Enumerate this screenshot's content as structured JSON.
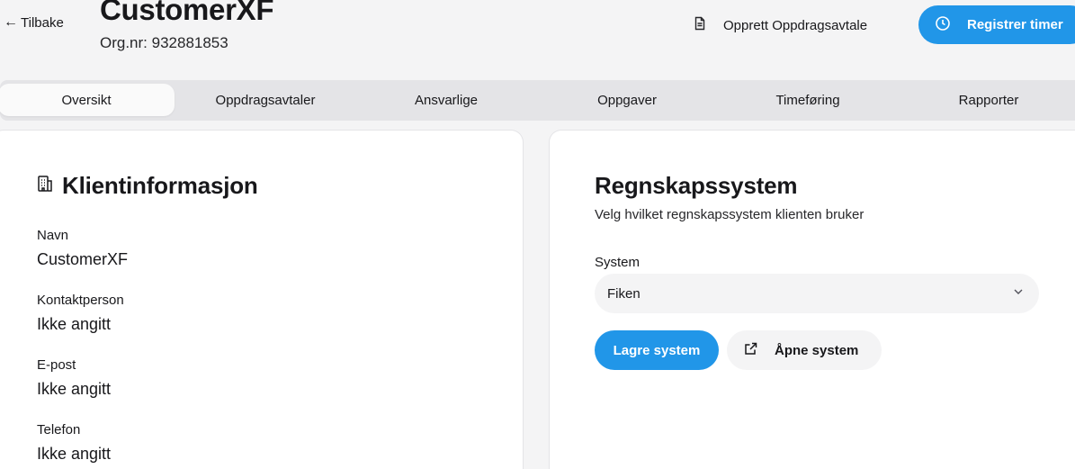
{
  "header": {
    "back_label": "Tilbake",
    "back_arrow": "←",
    "client_name": "CustomerXF",
    "org_number": "Org.nr: 932881853",
    "create_agreement_label": "Opprett Oppdragsavtale",
    "register_hours_label": "Registrer timer"
  },
  "tabs": [
    {
      "label": "Oversikt",
      "active": true
    },
    {
      "label": "Oppdragsavtaler",
      "active": false
    },
    {
      "label": "Ansvarlige",
      "active": false
    },
    {
      "label": "Oppgaver",
      "active": false
    },
    {
      "label": "Timeføring",
      "active": false
    },
    {
      "label": "Rapporter",
      "active": false
    }
  ],
  "client_info": {
    "title": "Klientinformasjon",
    "icon": "building-icon",
    "fields": [
      {
        "label": "Navn",
        "value": "CustomerXF"
      },
      {
        "label": "Kontaktperson",
        "value": "Ikke angitt"
      },
      {
        "label": "E-post",
        "value": "Ikke angitt"
      },
      {
        "label": "Telefon",
        "value": "Ikke angitt"
      }
    ]
  },
  "accounting": {
    "title": "Regnskapssystem",
    "subtitle": "Velg hvilket regnskapssystem klienten bruker",
    "system_label": "System",
    "selected_system": "Fiken",
    "save_label": "Lagre system",
    "open_label": "Åpne system"
  },
  "colors": {
    "accent": "#2196e8",
    "background": "#f4f4f5",
    "tab_bar": "#e4e4e7",
    "card": "#ffffff"
  }
}
